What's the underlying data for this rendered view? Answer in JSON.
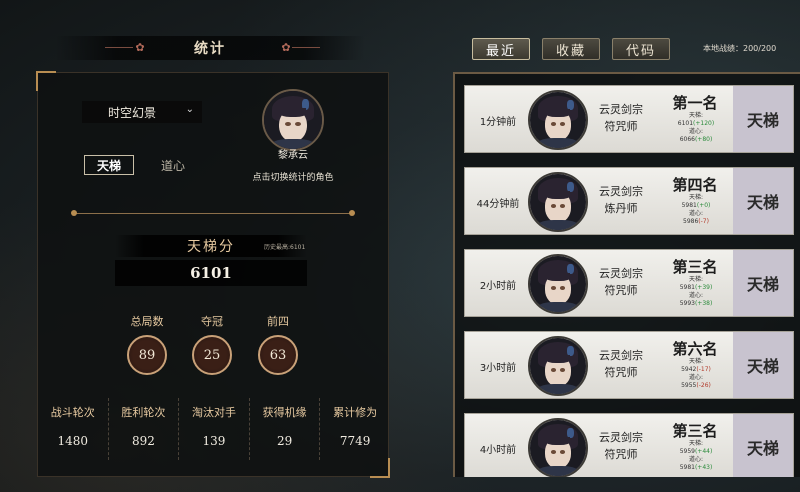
{
  "header": {
    "title": "统计",
    "tabs": [
      {
        "label": "最近",
        "active": true
      },
      {
        "label": "收藏",
        "active": false
      },
      {
        "label": "代码",
        "active": false
      }
    ],
    "local_records": "本地战绩：200/200"
  },
  "left": {
    "mode_select": "时空幻景",
    "character_name": "黎承云",
    "character_hint": "点击切换统计的角色",
    "tabs": [
      {
        "label": "天梯",
        "active": true
      },
      {
        "label": "道心",
        "active": false
      }
    ],
    "score_label": "天梯分",
    "history_high": "历史最高:6101",
    "score_value": "6101",
    "stats": [
      {
        "label": "总局数",
        "value": "89"
      },
      {
        "label": "夺冠",
        "value": "25"
      },
      {
        "label": "前四",
        "value": "63"
      }
    ],
    "bottom_stats": [
      {
        "label": "战斗轮次",
        "value": "1480"
      },
      {
        "label": "胜利轮次",
        "value": "892"
      },
      {
        "label": "淘汰对手",
        "value": "139"
      },
      {
        "label": "获得机缘",
        "value": "29"
      },
      {
        "label": "累计修为",
        "value": "7749"
      }
    ]
  },
  "records": [
    {
      "time": "1分钟前",
      "sect": "云灵剑宗",
      "role": "符咒师",
      "rank": "第一名",
      "ladder_label": "天梯:",
      "ladder": "6101",
      "ladder_delta": "(+120)",
      "dao_label": "道心:",
      "dao": "6066",
      "dao_delta": "(+80)",
      "mode": "天梯"
    },
    {
      "time": "44分钟前",
      "sect": "云灵剑宗",
      "role": "炼丹师",
      "rank": "第四名",
      "ladder_label": "天梯:",
      "ladder": "5981",
      "ladder_delta": "(+0)",
      "dao_label": "道心:",
      "dao": "5986",
      "dao_delta": "(-7)",
      "mode": "天梯"
    },
    {
      "time": "2小时前",
      "sect": "云灵剑宗",
      "role": "符咒师",
      "rank": "第三名",
      "ladder_label": "天梯:",
      "ladder": "5981",
      "ladder_delta": "(+39)",
      "dao_label": "道心:",
      "dao": "5993",
      "dao_delta": "(+38)",
      "mode": "天梯"
    },
    {
      "time": "3小时前",
      "sect": "云灵剑宗",
      "role": "符咒师",
      "rank": "第六名",
      "ladder_label": "天梯:",
      "ladder": "5942",
      "ladder_delta": "(-17)",
      "dao_label": "道心:",
      "dao": "5955",
      "dao_delta": "(-26)",
      "mode": "天梯"
    },
    {
      "time": "4小时前",
      "sect": "云灵剑宗",
      "role": "符咒师",
      "rank": "第三名",
      "ladder_label": "天梯:",
      "ladder": "5959",
      "ladder_delta": "(+44)",
      "dao_label": "道心:",
      "dao": "5981",
      "dao_delta": "(+43)",
      "mode": "天梯"
    }
  ],
  "colors": {
    "accent": "#c9a178",
    "positive": "#2a8a3a",
    "negative": "#b23a2a"
  }
}
